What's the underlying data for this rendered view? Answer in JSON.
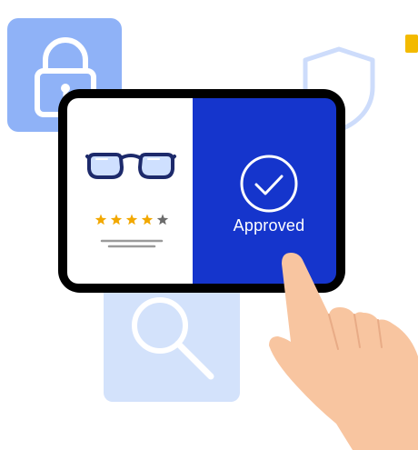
{
  "colors": {
    "tablet_frame": "#000000",
    "approved_panel": "#1535cc",
    "lock_card": "#8fb2f7",
    "search_card": "#d3e2fb",
    "shield_outline": "#cddcfb",
    "star_filled": "#f2a800",
    "star_empty": "#6b6b6b",
    "glasses_frame": "#1d2a6b",
    "glasses_lens": "#cfe0ff",
    "skin": "#f8c5a0",
    "accent": "#f3ba00"
  },
  "icons": {
    "lock": "padlock-icon",
    "shield": "shield-icon",
    "search": "magnifier-icon",
    "glasses": "glasses-icon",
    "check": "checkmark-circle-icon",
    "hand": "pointing-hand"
  },
  "product_card": {
    "rating": 4,
    "rating_max": 5
  },
  "status": {
    "label": "Approved"
  }
}
